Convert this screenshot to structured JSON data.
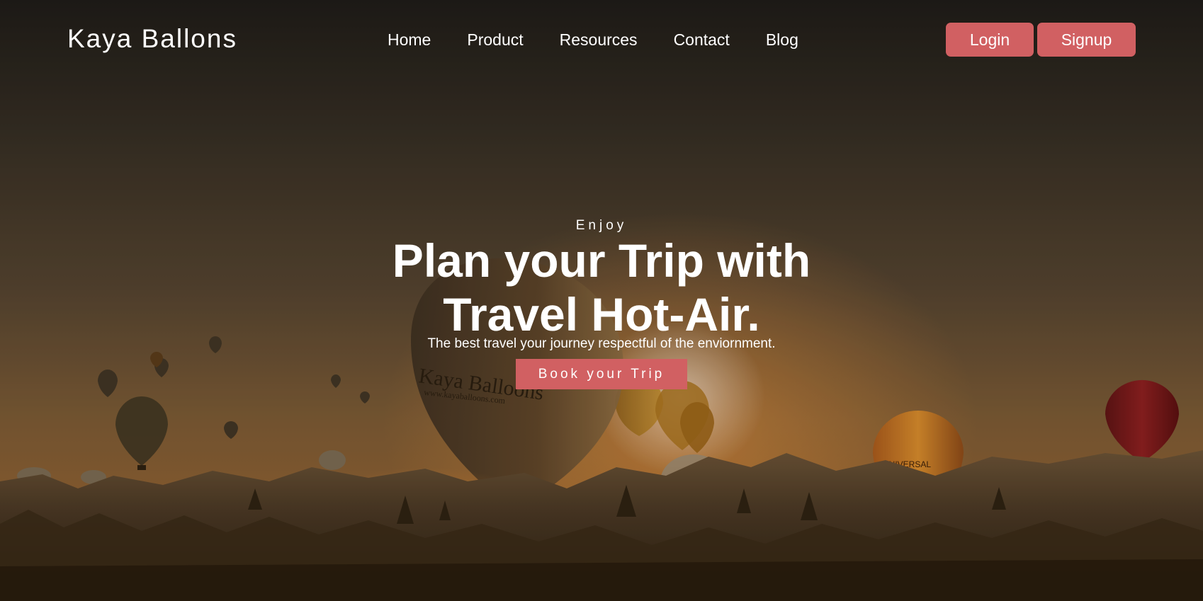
{
  "brand": {
    "name": "Kaya Ballons"
  },
  "nav": {
    "items": [
      {
        "label": "Home"
      },
      {
        "label": "Product"
      },
      {
        "label": "Resources"
      },
      {
        "label": "Contact"
      },
      {
        "label": "Blog"
      }
    ]
  },
  "auth": {
    "login_label": "Login",
    "signup_label": "Signup"
  },
  "hero": {
    "eyebrow": "Enjoy",
    "headline_line1": "Plan your Trip with",
    "headline_line2": "Travel Hot-Air.",
    "tagline": "The best travel your journey respectful of the enviornment.",
    "cta_label": "Book your Trip",
    "balloon_text": "Kaya Balloons",
    "balloon_url": "www.kayaballoons.com",
    "balloon_brand": "UNIVERSAL"
  },
  "colors": {
    "accent": "#d16062",
    "text": "#ffffff"
  }
}
